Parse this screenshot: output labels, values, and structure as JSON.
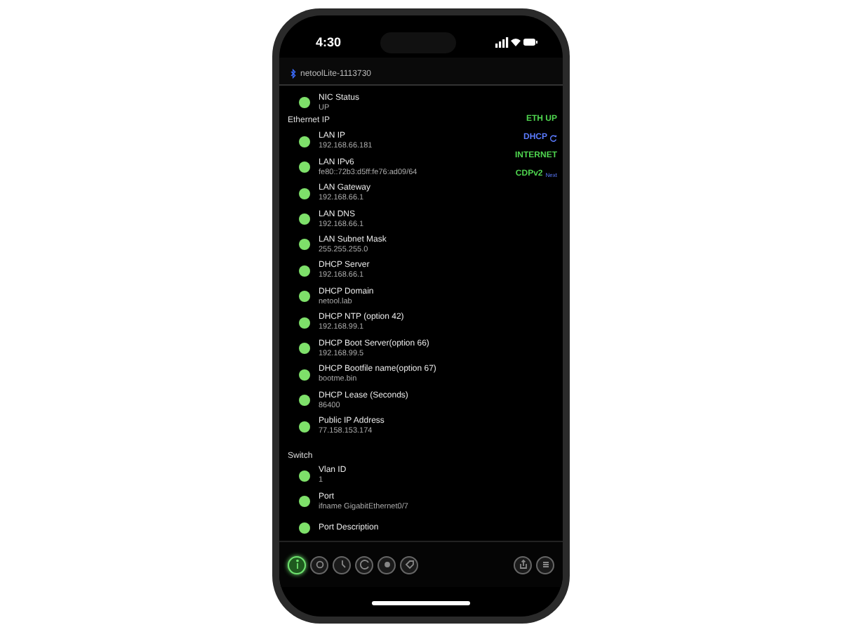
{
  "status_bar": {
    "time": "4:30"
  },
  "title_bar": {
    "title": "netoolLite-1113730"
  },
  "sections": [
    {
      "items": [
        {
          "name": "NIC Status",
          "value": "UP",
          "on": true
        }
      ]
    },
    {
      "heading": "Ethernet IP",
      "items": [
        {
          "name": "LAN IP",
          "value": "192.168.66.181",
          "on": true
        },
        {
          "name": "LAN IPv6",
          "value": "fe80::72b3:d5ff:fe76:ad09/64",
          "on": true
        },
        {
          "name": "LAN Gateway",
          "value": "192.168.66.1",
          "on": true
        },
        {
          "name": "LAN DNS",
          "value": "192.168.66.1",
          "on": true
        },
        {
          "name": "LAN Subnet Mask",
          "value": "255.255.255.0",
          "on": true
        },
        {
          "name": "DHCP Server",
          "value": "192.168.66.1",
          "on": true
        },
        {
          "name": "DHCP Domain",
          "value": "netool.lab",
          "on": true
        },
        {
          "name": "DHCP NTP (option 42)",
          "value": "192.168.99.1",
          "on": true
        },
        {
          "name": "DHCP Boot Server(option 66)",
          "value": "192.168.99.5",
          "on": true
        },
        {
          "name": "DHCP Bootfile name(option 67)",
          "value": "bootme.bin",
          "on": true
        },
        {
          "name": "DHCP Lease (Seconds)",
          "value": "86400",
          "on": true
        },
        {
          "name": "Public IP Address",
          "value": "77.158.153.174",
          "on": true
        }
      ]
    },
    {
      "heading": "Switch",
      "items": [
        {
          "name": "Vlan ID",
          "value": "1",
          "on": true
        },
        {
          "name": "Port",
          "value": "ifname GigabitEthernet0/7",
          "on": true
        },
        {
          "name": "Port Description",
          "on": true
        }
      ]
    }
  ],
  "badges": [
    {
      "label": "ETH UP",
      "kind": "text",
      "color": "#4fd64f"
    },
    {
      "label": "DHCP",
      "kind": "refresh",
      "color": "#5b7bff"
    },
    {
      "label": "INTERNET",
      "kind": "text",
      "color": "#4fd64f"
    },
    {
      "label": "CDPv2",
      "kind": "extra",
      "color": "#4fd64f",
      "extra": "Next"
    }
  ],
  "toolbar": [
    {
      "kind": "info",
      "selected": true
    },
    {
      "kind": "camera",
      "selected": false
    },
    {
      "kind": "clock",
      "selected": false
    },
    {
      "kind": "refresh",
      "selected": false
    },
    {
      "kind": "record",
      "selected": false
    },
    {
      "kind": "tag",
      "selected": false
    }
  ],
  "toolbar_right": [
    {
      "kind": "share",
      "selected": false
    },
    {
      "kind": "menu",
      "selected": false
    }
  ]
}
